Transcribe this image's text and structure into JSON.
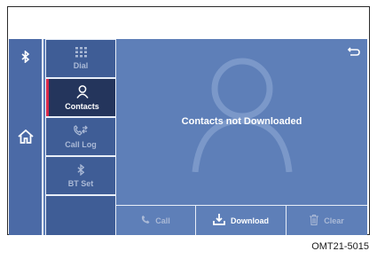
{
  "rail": {
    "bluetooth_icon": "bluetooth-icon",
    "home_icon": "home-icon"
  },
  "menu": {
    "items": [
      {
        "label": "Dial",
        "icon": "keypad-icon",
        "active": false,
        "enabled": true
      },
      {
        "label": "Contacts",
        "icon": "person-icon",
        "active": true,
        "enabled": true
      },
      {
        "label": "Call Log",
        "icon": "call-log-icon",
        "active": false,
        "enabled": false
      },
      {
        "label": "BT Set",
        "icon": "bluetooth-icon",
        "active": false,
        "enabled": false
      }
    ]
  },
  "main": {
    "message": "Contacts not Downloaded",
    "back_icon": "back-icon"
  },
  "bottom_bar": {
    "call_label": "Call",
    "download_label": "Download",
    "clear_label": "Clear"
  },
  "caption": "OMT21-5015",
  "colors": {
    "screen": "#5e7fb8",
    "rail": "#4b6aa6",
    "menu_item": "#3f5d96",
    "active_item": "#24355c",
    "active_marker": "#d8294a",
    "disabled_text": "#aab9d6"
  }
}
